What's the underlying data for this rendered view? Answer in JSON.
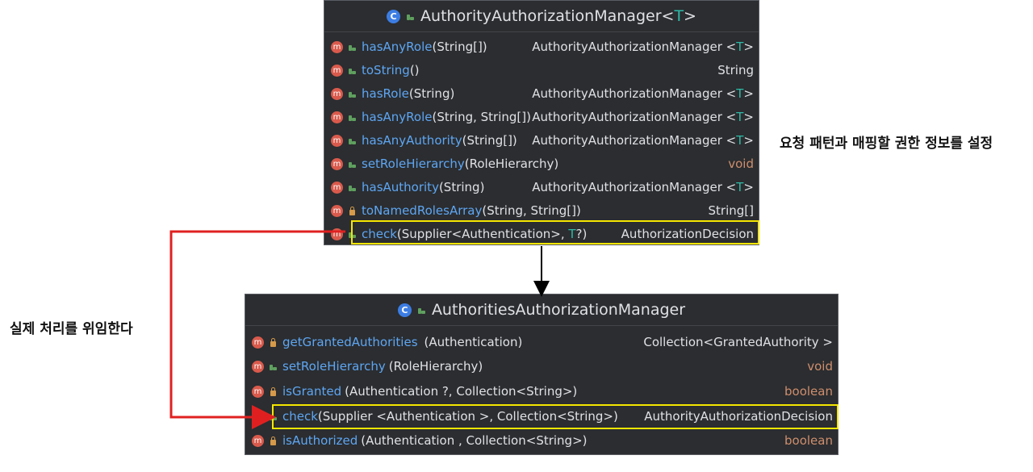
{
  "top_panel": {
    "title_name": "AuthorityAuthorizationManager",
    "title_type_open": "<",
    "title_type_param": "T",
    "title_type_close": ">",
    "rows": [
      {
        "name": "hasAnyRole",
        "params": "(String[])",
        "return": "AuthorityAuthorizationManager <",
        "return_t": "T",
        "return_close": ">"
      },
      {
        "name": "toString",
        "params": "()",
        "return": "String",
        "return_t": "",
        "return_close": ""
      },
      {
        "name": "hasRole",
        "params": "(String)",
        "return": "AuthorityAuthorizationManager <",
        "return_t": "T",
        "return_close": ">"
      },
      {
        "name": "hasAnyRole",
        "params": "(String, String[])",
        "return": "AuthorityAuthorizationManager <",
        "return_t": "T",
        "return_close": ">"
      },
      {
        "name": "hasAnyAuthority",
        "params": "(String[])",
        "return": "AuthorityAuthorizationManager <",
        "return_t": "T",
        "return_close": ">"
      },
      {
        "name": "setRoleHierarchy",
        "params": "(RoleHierarchy)",
        "return": "void",
        "return_t": "",
        "return_close": ""
      },
      {
        "name": "hasAuthority",
        "params": "(String)",
        "return": "AuthorityAuthorizationManager <",
        "return_t": "T",
        "return_close": ">"
      },
      {
        "name": "toNamedRolesArray",
        "params": "(String, String[])",
        "return": "String[]",
        "return_t": "",
        "return_close": ""
      },
      {
        "name": "check",
        "params": "(Supplier<Authentication>, ",
        "params_t": "T",
        "params_close": "?)",
        "return": "AuthorizationDecision",
        "return_t": "",
        "return_close": ""
      }
    ]
  },
  "bottom_panel": {
    "title_name": "AuthoritiesAuthorizationManager",
    "rows": [
      {
        "name": "getGrantedAuthorities",
        "params": "(Authentication)",
        "return": "Collection<GrantedAuthority >"
      },
      {
        "name": "setRoleHierarchy",
        "params": "(RoleHierarchy)",
        "return": "void"
      },
      {
        "name": "isGranted",
        "params": "(Authentication ?, Collection<String>)",
        "return": "boolean"
      },
      {
        "name": "check",
        "params": "(Supplier <Authentication >, Collection<String>)",
        "return": "AuthorityAuthorizationDecision"
      },
      {
        "name": "isAuthorized",
        "params": "(Authentication , Collection<String>)",
        "return": "boolean"
      }
    ]
  },
  "icons": {
    "class_letter": "C",
    "method_letter": "m"
  },
  "notes": {
    "right": "요청 패턴과 매핑할 권한 정보를 설정",
    "left": "실제 처리를 위임한다"
  },
  "colors": {
    "panel_bg": "#2b2d30",
    "method_name": "#5ea6f3",
    "type_param": "#2fbaa8",
    "orange_type": "#cf8e6d",
    "highlight": "#f5e600",
    "arrow_red": "#e02020"
  }
}
